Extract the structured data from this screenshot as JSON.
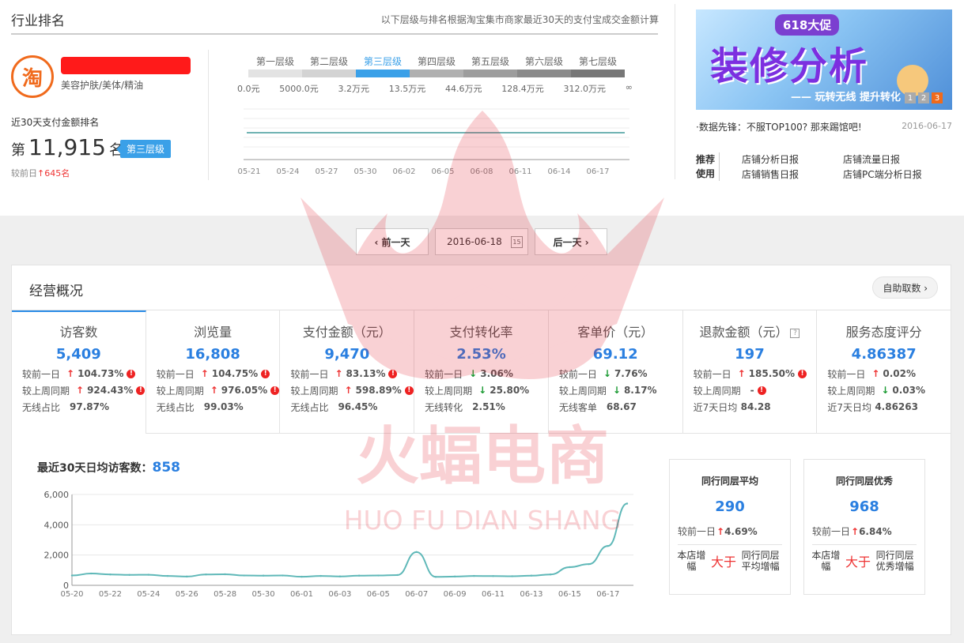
{
  "header": {
    "title": "行业排名",
    "note": "以下层级与排名根据淘宝集市商家最近30天的支付宝成交金额计算"
  },
  "shop": {
    "logo_char": "淘",
    "category": "美容护肤/美体/精油"
  },
  "rank": {
    "title": "近30天支付金额排名",
    "prefix": "第",
    "value": "11,915",
    "suffix": "名",
    "tier_badge": "第三层级",
    "change_label": "较前日",
    "change_arrow": "↑",
    "change_value": "645名"
  },
  "tiers": {
    "labels": [
      "第一层级",
      "第二层级",
      "第三层级",
      "第四层级",
      "第五层级",
      "第六层级",
      "第七层级"
    ],
    "active_index": 2,
    "bar_colors": [
      "#e3e3e3",
      "#d3d3d3",
      "#3aa0e8",
      "#b0b0b0",
      "#9d9d9d",
      "#8a8a8a",
      "#777777"
    ],
    "values": [
      "0.0元",
      "5000.0元",
      "3.2万元",
      "13.5万元",
      "44.6万元",
      "128.4万元",
      "312.0万元",
      "∞"
    ]
  },
  "mini_chart": {
    "x_labels": [
      "05-21",
      "05-24",
      "05-27",
      "05-30",
      "06-02",
      "06-05",
      "06-08",
      "06-11",
      "06-14",
      "06-17"
    ],
    "line_color": "#6fb3b3"
  },
  "banner": {
    "promo": "618大促",
    "main": "装修分析",
    "sub": "—— 玩转无线 提升转化",
    "pages": [
      "1",
      "2",
      "3"
    ],
    "active_page": 2
  },
  "news": {
    "text": "·数据先锋：不服TOP100? 那来踢馆吧!",
    "date": "2016-06-17"
  },
  "recommend": {
    "label_line1": "推荐",
    "label_line2": "使用",
    "links": [
      "店铺分析日报",
      "店铺流量日报",
      "店铺销售日报",
      "店铺PC端分析日报"
    ]
  },
  "watermark": {
    "cn": "火蝠电商",
    "en": "HUO FU DIAN SHANG"
  },
  "date_nav": {
    "prev": "‹ 前一天",
    "date": "2016-06-18",
    "cal_icon": "15",
    "next": "后一天 ›"
  },
  "panel": {
    "title": "经营概况",
    "auto_fetch": "自助取数 ›"
  },
  "kpis": [
    {
      "label": "访客数",
      "value": "5,409",
      "help": false,
      "rows": [
        {
          "label": "较前一日",
          "dir": "up",
          "value": "104.73%",
          "alert": true
        },
        {
          "label": "较上周同期",
          "dir": "up",
          "value": "924.43%",
          "alert": true
        },
        {
          "label": "无线占比",
          "dir": "",
          "value": "97.87%",
          "alert": false
        }
      ]
    },
    {
      "label": "浏览量",
      "value": "16,808",
      "help": false,
      "rows": [
        {
          "label": "较前一日",
          "dir": "up",
          "value": "104.75%",
          "alert": true
        },
        {
          "label": "较上周同期",
          "dir": "up",
          "value": "976.05%",
          "alert": true
        },
        {
          "label": "无线占比",
          "dir": "",
          "value": "99.03%",
          "alert": false
        }
      ]
    },
    {
      "label": "支付金额（元）",
      "value": "9,470",
      "help": false,
      "rows": [
        {
          "label": "较前一日",
          "dir": "up",
          "value": "83.13%",
          "alert": true
        },
        {
          "label": "较上周同期",
          "dir": "up",
          "value": "598.89%",
          "alert": true
        },
        {
          "label": "无线占比",
          "dir": "",
          "value": "96.45%",
          "alert": false
        }
      ]
    },
    {
      "label": "支付转化率",
      "value": "2.53%",
      "help": false,
      "rows": [
        {
          "label": "较前一日",
          "dir": "down",
          "value": "3.06%",
          "alert": false
        },
        {
          "label": "较上周同期",
          "dir": "down",
          "value": "25.80%",
          "alert": false
        },
        {
          "label": "无线转化",
          "dir": "",
          "value": "2.51%",
          "alert": false
        }
      ]
    },
    {
      "label": "客单价（元）",
      "value": "69.12",
      "help": false,
      "rows": [
        {
          "label": "较前一日",
          "dir": "down",
          "value": "7.76%",
          "alert": false
        },
        {
          "label": "较上周同期",
          "dir": "down",
          "value": "8.17%",
          "alert": false
        },
        {
          "label": "无线客单",
          "dir": "",
          "value": "68.67",
          "alert": false
        }
      ]
    },
    {
      "label": "退款金额（元）",
      "value": "197",
      "help": true,
      "rows": [
        {
          "label": "较前一日",
          "dir": "up",
          "value": "185.50%",
          "alert": true
        },
        {
          "label": "较上周同期",
          "dir": "",
          "value": "-",
          "alert": true
        },
        {
          "label": "近7天日均",
          "dir": "",
          "value": "84.28",
          "alert": false
        }
      ]
    },
    {
      "label": "服务态度评分",
      "value": "4.86387",
      "help": false,
      "rows": [
        {
          "label": "较前一日",
          "dir": "up",
          "value": "0.02%",
          "alert": false
        },
        {
          "label": "较上周同期",
          "dir": "down",
          "value": "0.03%",
          "alert": false
        },
        {
          "label": "近7天日均",
          "dir": "",
          "value": "4.86263",
          "alert": false
        }
      ]
    }
  ],
  "trend": {
    "title": "最近30天日均访客数：",
    "value": "858"
  },
  "chart_data": {
    "type": "line",
    "x": [
      "05-20",
      "05-21",
      "05-22",
      "05-23",
      "05-24",
      "05-25",
      "05-26",
      "05-27",
      "05-28",
      "05-29",
      "05-30",
      "05-31",
      "06-01",
      "06-02",
      "06-03",
      "06-04",
      "06-05",
      "06-06",
      "06-07",
      "06-08",
      "06-09",
      "06-10",
      "06-11",
      "06-12",
      "06-13",
      "06-14",
      "06-15",
      "06-16",
      "06-17",
      "06-18"
    ],
    "x_tick_labels": [
      "05-20",
      "05-22",
      "05-24",
      "05-26",
      "05-28",
      "05-30",
      "06-01",
      "06-03",
      "06-05",
      "06-07",
      "06-09",
      "06-11",
      "06-13",
      "06-15",
      "06-17"
    ],
    "values": [
      650,
      780,
      720,
      690,
      700,
      620,
      580,
      720,
      730,
      650,
      640,
      650,
      570,
      620,
      590,
      640,
      650,
      680,
      2200,
      560,
      580,
      620,
      610,
      600,
      640,
      720,
      1200,
      1400,
      2600,
      5400
    ],
    "yticks": [
      0,
      2000,
      4000,
      6000
    ],
    "ytick_labels": [
      "0",
      "2,000",
      "4,000",
      "6,000"
    ],
    "ylim": [
      0,
      6000
    ],
    "line_color": "#5fb8b8",
    "grid": true
  },
  "compare": [
    {
      "title": "同行同层平均",
      "value": "290",
      "change_label": "较前一日",
      "change_dir": "up",
      "change_value": "4.69%",
      "left": "本店增幅",
      "mid": "大于",
      "right": "同行同层平均增幅"
    },
    {
      "title": "同行同层优秀",
      "value": "968",
      "change_label": "较前一日",
      "change_dir": "up",
      "change_value": "6.84%",
      "left": "本店增幅",
      "mid": "大于",
      "right": "同行同层优秀增幅"
    }
  ]
}
